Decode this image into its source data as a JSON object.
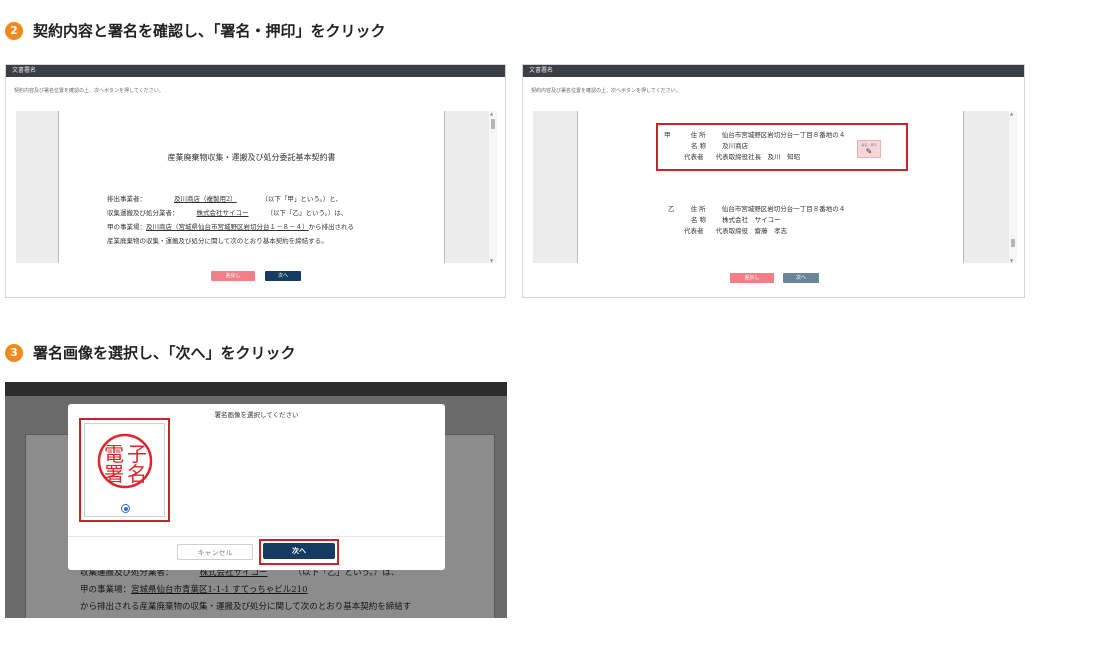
{
  "step2": {
    "num": "2",
    "heading": "契約内容と署名を確認し、「署名・押印」をクリック"
  },
  "step3": {
    "num": "3",
    "heading": "署名画像を選択し、「次へ」をクリック"
  },
  "shot_left": {
    "window_title": "文書署名",
    "instruction": "契約内容及び署名位置を確認の上、次へボタンを押してください。",
    "doc_title": "産業廃棄物収集・運搬及び処分委託基本契約書",
    "lines": {
      "l1_label": "排出事業者：",
      "l1_value": "及川商店（複製用2）",
      "l1_tail": "（以下「甲」という。）と、",
      "l2_label": "収集運搬及び処分業者：",
      "l2_value": "株式会社サイコー",
      "l2_tail": "（以下「乙」という。）は、",
      "l3_label": "甲の事業場：",
      "l3_value": "及川商店（宮城県仙台市宮城野区岩切分台１－８－４）",
      "l3_tail": "から排出される",
      "l4": "産業廃棄物の収集・運搬及び処分に関して次のとおり基本契約を締結する。"
    },
    "btn_back": "差戻し",
    "btn_next": "次へ"
  },
  "shot_right": {
    "window_title": "文書署名",
    "instruction": "契約内容及び署名位置を確認の上、次へボタンを押してください。",
    "party_a": {
      "mark": "甲",
      "address_label": "住 所",
      "address": "仙台市宮城野区岩切分台一丁目８番地の４",
      "name_label": "名 称",
      "name": "及川商店",
      "rep_label": "代表者",
      "rep": "代表取締役社長　及川　知昭",
      "stamp_hint": "署名・押印"
    },
    "party_b": {
      "mark": "乙",
      "address_label": "住 所",
      "address": "仙台市宮城野区岩切分台一丁目８番地の４",
      "name_label": "名 称",
      "name": "株式会社　サイコー",
      "rep_label": "代表者",
      "rep": "代表取締役　齋藤　孝志"
    },
    "btn_back": "差戻し",
    "btn_next": "次へ"
  },
  "shot_modal": {
    "bg_lines": {
      "l1_label": "収集運搬及び処分業者：",
      "l1_value": "株式会社サイコー",
      "l1_tail": "（以下「乙」という。）は、",
      "l2_label": "甲の事業場：",
      "l2_value": "宮城県仙台市青葉区1-1-1 すてっちゃビル210",
      "l3": "から排出される産業廃棄物の収集・運搬及び処分に関して次のとおり基本契約を締結す"
    },
    "modal_title": "署名画像を選択してください",
    "seal": {
      "chars": [
        "子",
        "名",
        "電",
        "署"
      ],
      "color": "#e0242b"
    },
    "btn_cancel": "キャンセル",
    "btn_next": "次へ"
  },
  "colors": {
    "step_badge": "#f08a1c",
    "highlight_red": "#c8242b",
    "navy": "#163c63",
    "pink": "#f27f87"
  }
}
